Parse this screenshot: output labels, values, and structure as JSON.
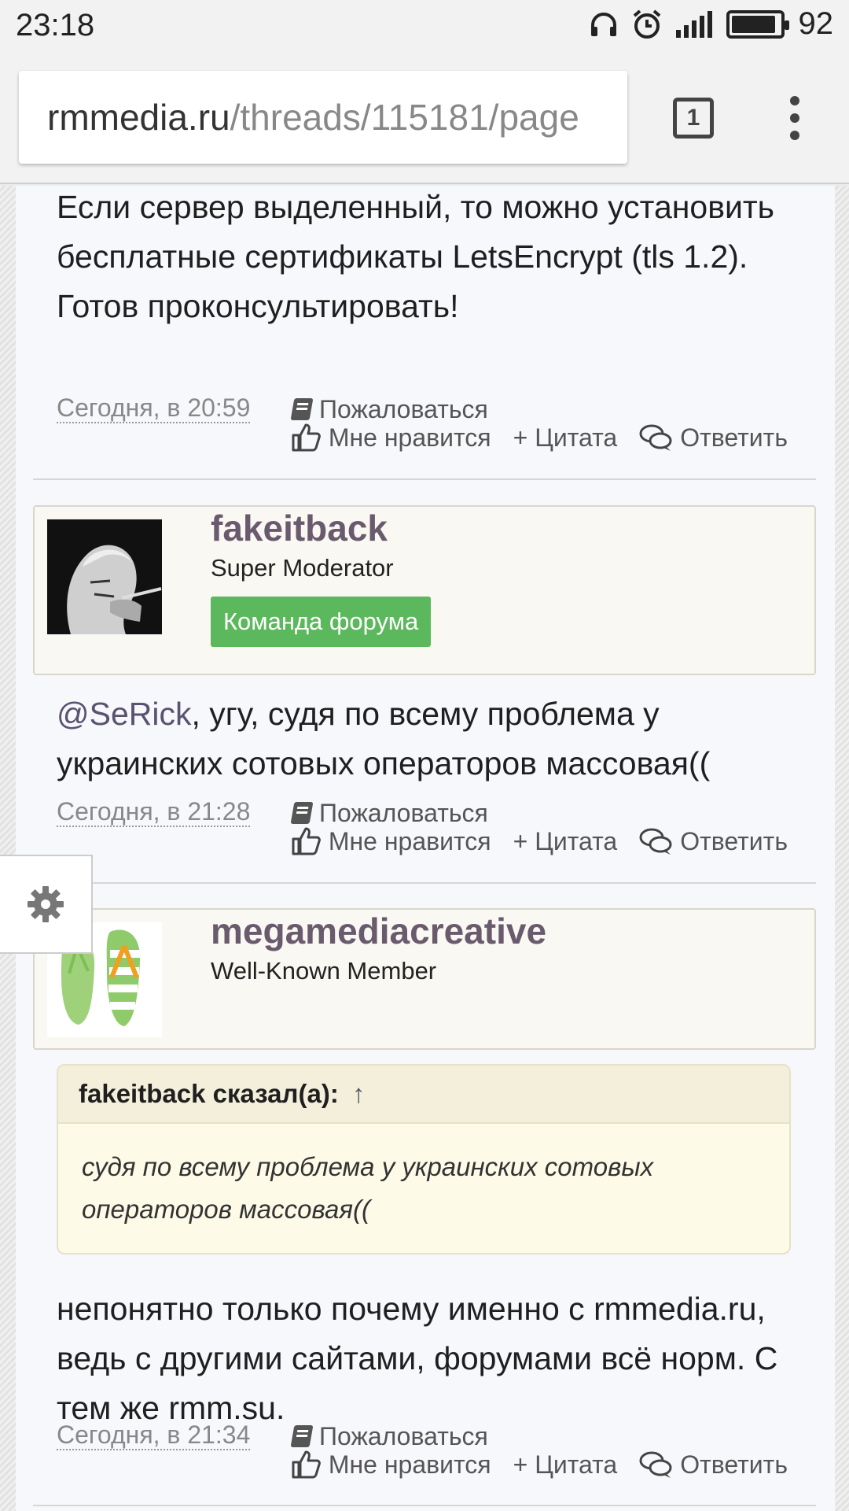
{
  "status_bar": {
    "time": "23:18",
    "battery": "92",
    "battery_level": 0.92
  },
  "browser": {
    "url_domain": "rmmedia.ru",
    "url_path": "/threads/115181/page",
    "tab_count": "1"
  },
  "posts": [
    {
      "body_lines": [
        "Если сервер выделенный, то можно установить бесплатные сертификаты LetsEncrypt (tls 1.2).",
        "Готов проконсультировать!"
      ],
      "date": "Сегодня, в 20:59"
    },
    {
      "author": {
        "name": "fakeitback",
        "title": "Super Moderator",
        "badge": "Команда форума"
      },
      "mention": "@SeRick",
      "body": ", угу, судя по всему проблема у украинских сотовых операторов массовая((",
      "date": "Сегодня, в 21:28"
    },
    {
      "author": {
        "name": "megamediacreative",
        "title": "Well-Known Member"
      },
      "quote": {
        "header": "fakeitback сказал(а):",
        "arrow": "↑",
        "text": "судя по всему проблема у украинских сотовых операторов массовая(("
      },
      "body": "непонятно только почему именно с rmmedia.ru, ведь с другими сайтами, форумами всё норм. С тем же rmm.su.",
      "date": "Сегодня, в 21:34"
    }
  ],
  "actions": {
    "report": "Пожаловаться",
    "like": "Мне нравится",
    "quote": "+ Цитата",
    "reply": "Ответить"
  }
}
